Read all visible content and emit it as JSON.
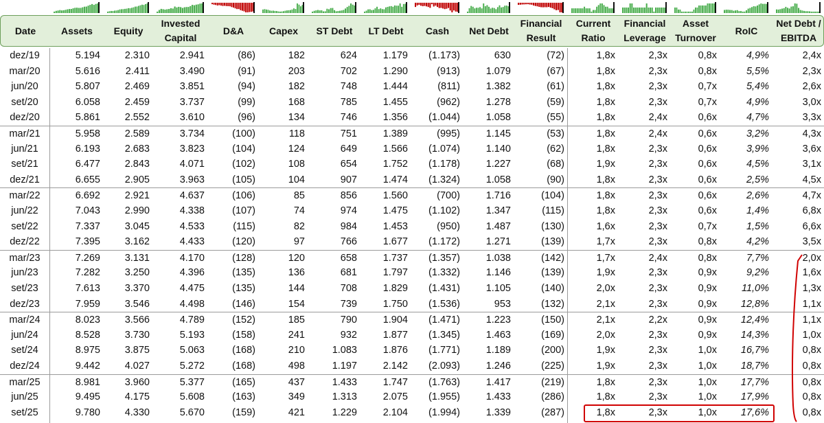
{
  "colors": {
    "header_bg": "#e2efda",
    "spark_green": "#4caf50",
    "spark_red": "#c00000",
    "highlight": "#d00000"
  },
  "columns": [
    {
      "key": "date",
      "label": "Date"
    },
    {
      "key": "assets",
      "label": "Assets"
    },
    {
      "key": "equity",
      "label": "Equity"
    },
    {
      "key": "ic",
      "label": "Invested Capital"
    },
    {
      "key": "da",
      "label": "D&A"
    },
    {
      "key": "capex",
      "label": "Capex"
    },
    {
      "key": "std",
      "label": "ST Debt"
    },
    {
      "key": "ltd",
      "label": "LT Debt"
    },
    {
      "key": "cash",
      "label": "Cash"
    },
    {
      "key": "nd",
      "label": "Net Debt"
    },
    {
      "key": "fr",
      "label": "Financial Result"
    },
    {
      "key": "cr",
      "label": "Current Ratio"
    },
    {
      "key": "fl",
      "label": "Financial Leverage"
    },
    {
      "key": "at",
      "label": "Asset Turnover"
    },
    {
      "key": "roic",
      "label": "RoIC"
    },
    {
      "key": "nde",
      "label": "Net Debt / EBITDA"
    }
  ],
  "rows": [
    [
      "dez/19",
      "5.194",
      "2.310",
      "2.941",
      "(86)",
      "182",
      "624",
      "1.179",
      "(1.173)",
      "630",
      "(72)",
      "1,8x",
      "2,3x",
      "0,8x",
      "4,9%",
      "2,4x"
    ],
    [
      "mar/20",
      "5.616",
      "2.411",
      "3.490",
      "(91)",
      "203",
      "702",
      "1.290",
      "(913)",
      "1.079",
      "(67)",
      "1,8x",
      "2,3x",
      "0,8x",
      "5,5%",
      "2,3x"
    ],
    [
      "jun/20",
      "5.807",
      "2.469",
      "3.851",
      "(94)",
      "182",
      "748",
      "1.444",
      "(811)",
      "1.382",
      "(61)",
      "1,8x",
      "2,3x",
      "0,7x",
      "5,4%",
      "2,6x"
    ],
    [
      "set/20",
      "6.058",
      "2.459",
      "3.737",
      "(99)",
      "168",
      "785",
      "1.455",
      "(962)",
      "1.278",
      "(59)",
      "1,8x",
      "2,3x",
      "0,7x",
      "4,9%",
      "3,0x"
    ],
    [
      "dez/20",
      "5.861",
      "2.552",
      "3.610",
      "(96)",
      "134",
      "746",
      "1.356",
      "(1.044)",
      "1.058",
      "(55)",
      "1,8x",
      "2,4x",
      "0,6x",
      "4,7%",
      "3,3x"
    ],
    [
      "mar/21",
      "5.958",
      "2.589",
      "3.734",
      "(100)",
      "118",
      "751",
      "1.389",
      "(995)",
      "1.145",
      "(53)",
      "1,8x",
      "2,4x",
      "0,6x",
      "3,2%",
      "4,3x"
    ],
    [
      "jun/21",
      "6.193",
      "2.683",
      "3.823",
      "(104)",
      "124",
      "649",
      "1.566",
      "(1.074)",
      "1.140",
      "(62)",
      "1,8x",
      "2,3x",
      "0,6x",
      "3,9%",
      "3,6x"
    ],
    [
      "set/21",
      "6.477",
      "2.843",
      "4.071",
      "(102)",
      "108",
      "654",
      "1.752",
      "(1.178)",
      "1.227",
      "(68)",
      "1,9x",
      "2,3x",
      "0,6x",
      "4,5%",
      "3,1x"
    ],
    [
      "dez/21",
      "6.655",
      "2.905",
      "3.963",
      "(105)",
      "104",
      "907",
      "1.474",
      "(1.324)",
      "1.058",
      "(90)",
      "1,8x",
      "2,3x",
      "0,6x",
      "2,5%",
      "4,5x"
    ],
    [
      "mar/22",
      "6.692",
      "2.921",
      "4.637",
      "(106)",
      "85",
      "856",
      "1.560",
      "(700)",
      "1.716",
      "(104)",
      "1,8x",
      "2,3x",
      "0,6x",
      "2,6%",
      "4,7x"
    ],
    [
      "jun/22",
      "7.043",
      "2.990",
      "4.338",
      "(107)",
      "74",
      "974",
      "1.475",
      "(1.102)",
      "1.347",
      "(115)",
      "1,8x",
      "2,3x",
      "0,6x",
      "1,4%",
      "6,8x"
    ],
    [
      "set/22",
      "7.337",
      "3.045",
      "4.533",
      "(115)",
      "82",
      "984",
      "1.453",
      "(950)",
      "1.487",
      "(130)",
      "1,6x",
      "2,3x",
      "0,7x",
      "1,5%",
      "6,6x"
    ],
    [
      "dez/22",
      "7.395",
      "3.162",
      "4.433",
      "(120)",
      "97",
      "766",
      "1.677",
      "(1.172)",
      "1.271",
      "(139)",
      "1,7x",
      "2,3x",
      "0,8x",
      "4,2%",
      "3,5x"
    ],
    [
      "mar/23",
      "7.269",
      "3.131",
      "4.170",
      "(128)",
      "120",
      "658",
      "1.737",
      "(1.357)",
      "1.038",
      "(142)",
      "1,7x",
      "2,4x",
      "0,8x",
      "7,7%",
      "2,0x"
    ],
    [
      "jun/23",
      "7.282",
      "3.250",
      "4.396",
      "(135)",
      "136",
      "681",
      "1.797",
      "(1.332)",
      "1.146",
      "(139)",
      "1,9x",
      "2,3x",
      "0,9x",
      "9,2%",
      "1,6x"
    ],
    [
      "set/23",
      "7.613",
      "3.370",
      "4.475",
      "(135)",
      "144",
      "708",
      "1.829",
      "(1.431)",
      "1.105",
      "(140)",
      "2,0x",
      "2,3x",
      "0,9x",
      "11,0%",
      "1,3x"
    ],
    [
      "dez/23",
      "7.959",
      "3.546",
      "4.498",
      "(146)",
      "154",
      "739",
      "1.750",
      "(1.536)",
      "953",
      "(132)",
      "2,1x",
      "2,3x",
      "0,9x",
      "12,8%",
      "1,1x"
    ],
    [
      "mar/24",
      "8.023",
      "3.566",
      "4.789",
      "(152)",
      "185",
      "790",
      "1.904",
      "(1.471)",
      "1.223",
      "(150)",
      "2,1x",
      "2,2x",
      "0,9x",
      "12,4%",
      "1,1x"
    ],
    [
      "jun/24",
      "8.528",
      "3.730",
      "5.193",
      "(158)",
      "241",
      "932",
      "1.877",
      "(1.345)",
      "1.463",
      "(169)",
      "2,0x",
      "2,3x",
      "0,9x",
      "14,3%",
      "1,0x"
    ],
    [
      "set/24",
      "8.975",
      "3.875",
      "5.063",
      "(168)",
      "210",
      "1.083",
      "1.876",
      "(1.771)",
      "1.189",
      "(200)",
      "1,9x",
      "2,3x",
      "1,0x",
      "16,7%",
      "0,8x"
    ],
    [
      "dez/24",
      "9.442",
      "4.027",
      "5.272",
      "(168)",
      "498",
      "1.197",
      "2.142",
      "(2.093)",
      "1.246",
      "(225)",
      "1,9x",
      "2,3x",
      "1,0x",
      "18,7%",
      "0,8x"
    ],
    [
      "mar/25",
      "8.981",
      "3.960",
      "5.377",
      "(165)",
      "437",
      "1.433",
      "1.747",
      "(1.763)",
      "1.417",
      "(219)",
      "1,8x",
      "2,3x",
      "1,0x",
      "17,7%",
      "0,8x"
    ],
    [
      "jun/25",
      "9.495",
      "4.175",
      "5.608",
      "(163)",
      "349",
      "1.313",
      "2.075",
      "(1.955)",
      "1.433",
      "(286)",
      "1,8x",
      "2,3x",
      "1,0x",
      "17,9%",
      "0,8x"
    ],
    [
      "set/25",
      "9.780",
      "4.330",
      "5.670",
      "(159)",
      "421",
      "1.229",
      "2.104",
      "(1.994)",
      "1.339",
      "(287)",
      "1,8x",
      "2,3x",
      "1,0x",
      "17,6%",
      "0,8x"
    ]
  ],
  "sparklines": [
    {
      "column": "assets",
      "color": "#4caf50"
    },
    {
      "column": "equity",
      "color": "#4caf50"
    },
    {
      "column": "ic",
      "color": "#4caf50"
    },
    {
      "column": "da",
      "color": "#c00000"
    },
    {
      "column": "capex",
      "color": "#4caf50"
    },
    {
      "column": "std",
      "color": "#4caf50"
    },
    {
      "column": "ltd",
      "color": "#4caf50"
    },
    {
      "column": "cash",
      "color": "#c00000"
    },
    {
      "column": "nd",
      "color": "#4caf50"
    },
    {
      "column": "fr",
      "color": "#c00000"
    },
    {
      "column": "cr",
      "color": "#4caf50"
    },
    {
      "column": "fl",
      "color": "#4caf50"
    },
    {
      "column": "at",
      "color": "#4caf50"
    },
    {
      "column": "roic",
      "color": "#4caf50"
    },
    {
      "column": "nde",
      "color": "#4caf50"
    }
  ]
}
